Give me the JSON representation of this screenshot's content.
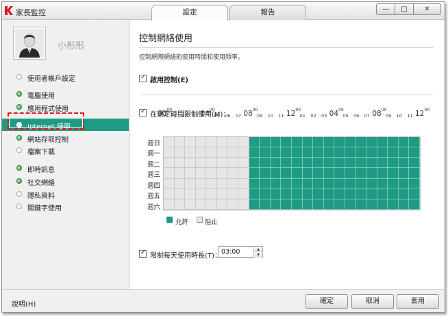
{
  "window": {
    "title": "家長監控",
    "tabs": [
      {
        "label": "設定",
        "active": true
      },
      {
        "label": "報告",
        "active": false
      }
    ],
    "controls": {
      "minimize": "—",
      "maximize": "□",
      "close": "✕"
    }
  },
  "sidebar": {
    "user_name": "小彤彤",
    "items": [
      {
        "label": "使用者帳戶設定",
        "status": "off"
      },
      {
        "label": "電腦使用",
        "status": "on"
      },
      {
        "label": "應用程式使用",
        "status": "on"
      },
      {
        "label": "Internet 使用",
        "status": "on",
        "selected": true
      },
      {
        "label": "網站存取控制",
        "status": "on"
      },
      {
        "label": "檔案下載",
        "status": "off"
      },
      {
        "label": "即時訊息",
        "status": "on"
      },
      {
        "label": "社交網絡",
        "status": "on"
      },
      {
        "label": "隱私資料",
        "status": "off"
      },
      {
        "label": "關鍵字使用",
        "status": "off"
      }
    ]
  },
  "main": {
    "title": "控制網絡使用",
    "description": "控制網際網絡的使用時間和使用頻率。",
    "enable_control": {
      "label": "啟用控制(E)",
      "checked": true
    },
    "limit_schedule": {
      "label": "在選定時間限制使用(M)：",
      "checked": true
    },
    "schedule": {
      "hour_labels": [
        {
          "text": "00",
          "big": true
        },
        {
          "text": "01"
        },
        {
          "text": "02"
        },
        {
          "text": "03"
        },
        {
          "text": "04",
          "big": true
        },
        {
          "text": "05"
        },
        {
          "text": "06"
        },
        {
          "text": "07"
        },
        {
          "text": "08",
          "big": true
        },
        {
          "text": "09"
        },
        {
          "text": "10"
        },
        {
          "text": "11"
        },
        {
          "text": "12",
          "big": true
        },
        {
          "text": "01"
        },
        {
          "text": "02"
        },
        {
          "text": "03"
        },
        {
          "text": "04",
          "big": true
        },
        {
          "text": "05"
        },
        {
          "text": "06"
        },
        {
          "text": "07"
        },
        {
          "text": "08",
          "big": true
        },
        {
          "text": "09"
        },
        {
          "text": "10"
        },
        {
          "text": "11"
        },
        {
          "text": "12",
          "big": true
        }
      ],
      "days": [
        "週日",
        "週一",
        "週二",
        "週三",
        "週四",
        "週五",
        "週六"
      ],
      "allowed_from_hour": 8,
      "legend": {
        "allow": "允許",
        "block": "阻止"
      },
      "colors": {
        "allow": "#1f9b83",
        "block": "#e6e6e6"
      }
    },
    "limit_daily": {
      "label": "限制每天使用時長(T)：",
      "checked": true,
      "value": "03:00"
    }
  },
  "footer": {
    "help": "說明(H)",
    "ok": "確定",
    "cancel": "取消",
    "apply": "套用"
  }
}
